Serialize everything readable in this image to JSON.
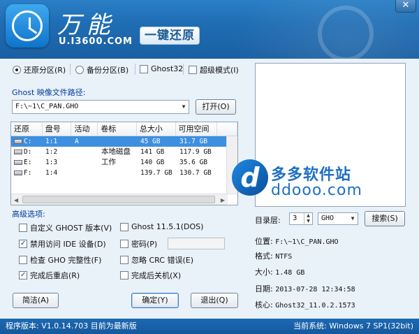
{
  "header": {
    "brand_cn": "万能",
    "brand_url": "U.I3600.COM",
    "badge": "一键还原",
    "close": "✕"
  },
  "modes": {
    "restore": "还原分区(R)",
    "backup": "备份分区(B)",
    "ghost32": "Ghost32",
    "super": "超级模式(I)"
  },
  "path": {
    "label": "Ghost 映像文件路径:",
    "value": "F:\\~1\\C_PAN.GHO",
    "open_button": "打开(O)"
  },
  "table": {
    "columns": [
      "还原",
      "盘号",
      "活动",
      "卷标",
      "总大小",
      "可用空间"
    ],
    "rows": [
      {
        "drive": "C:",
        "num": "1:1",
        "active": "A",
        "label": "",
        "total": "45 GB",
        "free": "31.7 GB",
        "selected": true
      },
      {
        "drive": "D:",
        "num": "1:2",
        "active": "",
        "label": "本地磁盘",
        "total": "141 GB",
        "free": "117.9 GB",
        "selected": false
      },
      {
        "drive": "E:",
        "num": "1:3",
        "active": "",
        "label": "工作",
        "total": "140 GB",
        "free": "35.6 GB",
        "selected": false
      },
      {
        "drive": "F:",
        "num": "1:4",
        "active": "",
        "label": "",
        "total": "139.7 GB",
        "free": "130.7 GB",
        "selected": false
      }
    ]
  },
  "advanced": {
    "title": "高级选项:",
    "custom_ghost": "自定义 GHOST 版本(V)",
    "ghost_ver": "Ghost 11.5.1(DOS)",
    "disable_ide": "禁用访问 IDE 设备(D)",
    "password": "密码(P)",
    "check_gho": "检查 GHO 完整性(F)",
    "ignore_crc": "忽略 CRC 错误(E)",
    "reboot": "完成后重启(R)",
    "shutdown": "完成后关机(X)"
  },
  "buttons": {
    "simple": "简洁(A)",
    "ok": "确定(Y)",
    "exit": "退出(Q)",
    "search": "搜索(S)"
  },
  "details": {
    "dir_level_label": "目录层:",
    "dir_level": "3",
    "ext": "GHO",
    "location_label": "位置:",
    "location": "F:\\~1\\C_PAN.GHO",
    "format_label": "格式:",
    "format": "NTFS",
    "size_label": "大小:",
    "size": "1.48 GB",
    "date_label": "日期:",
    "date": "2013-07-28  12:34:58",
    "core_label": "核心:",
    "core": "Ghost32_11.0.2.1573"
  },
  "watermark": {
    "cn": "多多软件站",
    "en": "ddooo.com"
  },
  "status": {
    "version": "程序版本: V1.0.14.703  目前为最新版",
    "system": "当前系统: Windows 7 SP1(32bit)"
  }
}
